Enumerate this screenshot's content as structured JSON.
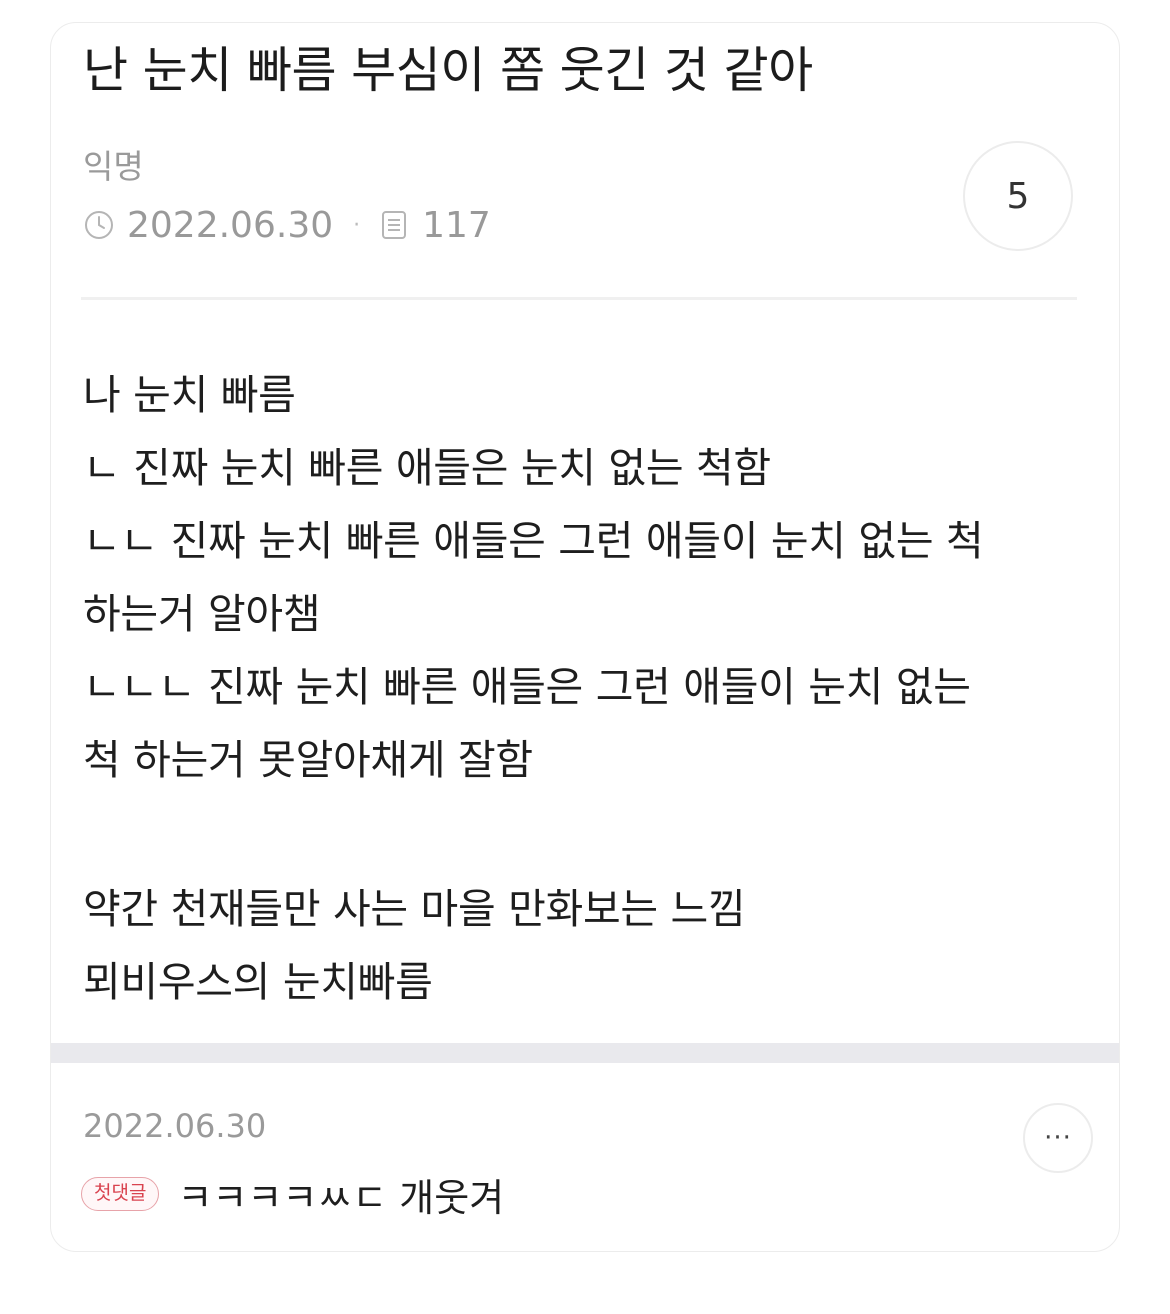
{
  "post": {
    "title": "난 눈치 빠름 부심이 쫌 웃긴 것 같아",
    "author": "익명",
    "date": "2022.06.30",
    "views": "117",
    "comment_count": "5",
    "body": {
      "lines": [
        "나 눈치 빠름",
        "ㄴ 진짜 눈치 빠른 애들은 눈치 없는 척함",
        "ㄴㄴ 진짜 눈치 빠른 애들은 그런 애들이 눈치 없는 척",
        "하는거 알아챔",
        "ㄴㄴㄴ 진짜 눈치 빠른 애들은 그런 애들이 눈치 없는",
        "척 하는거 못알아채게 잘함",
        "약간 천재들만 사는 마을 만화보는 느낌",
        "뫼비우스의 눈치빠름"
      ]
    }
  },
  "comment": {
    "date": "2022.06.30",
    "badge": "첫댓글",
    "text": "ㅋㅋㅋㅋㅆㄷ 개웃겨",
    "more_label": "···"
  },
  "icons": {
    "date": "clock-icon",
    "views": "document-icon",
    "more": "more-icon"
  },
  "colors": {
    "badge": "#d9434f",
    "muted": "#999999"
  }
}
